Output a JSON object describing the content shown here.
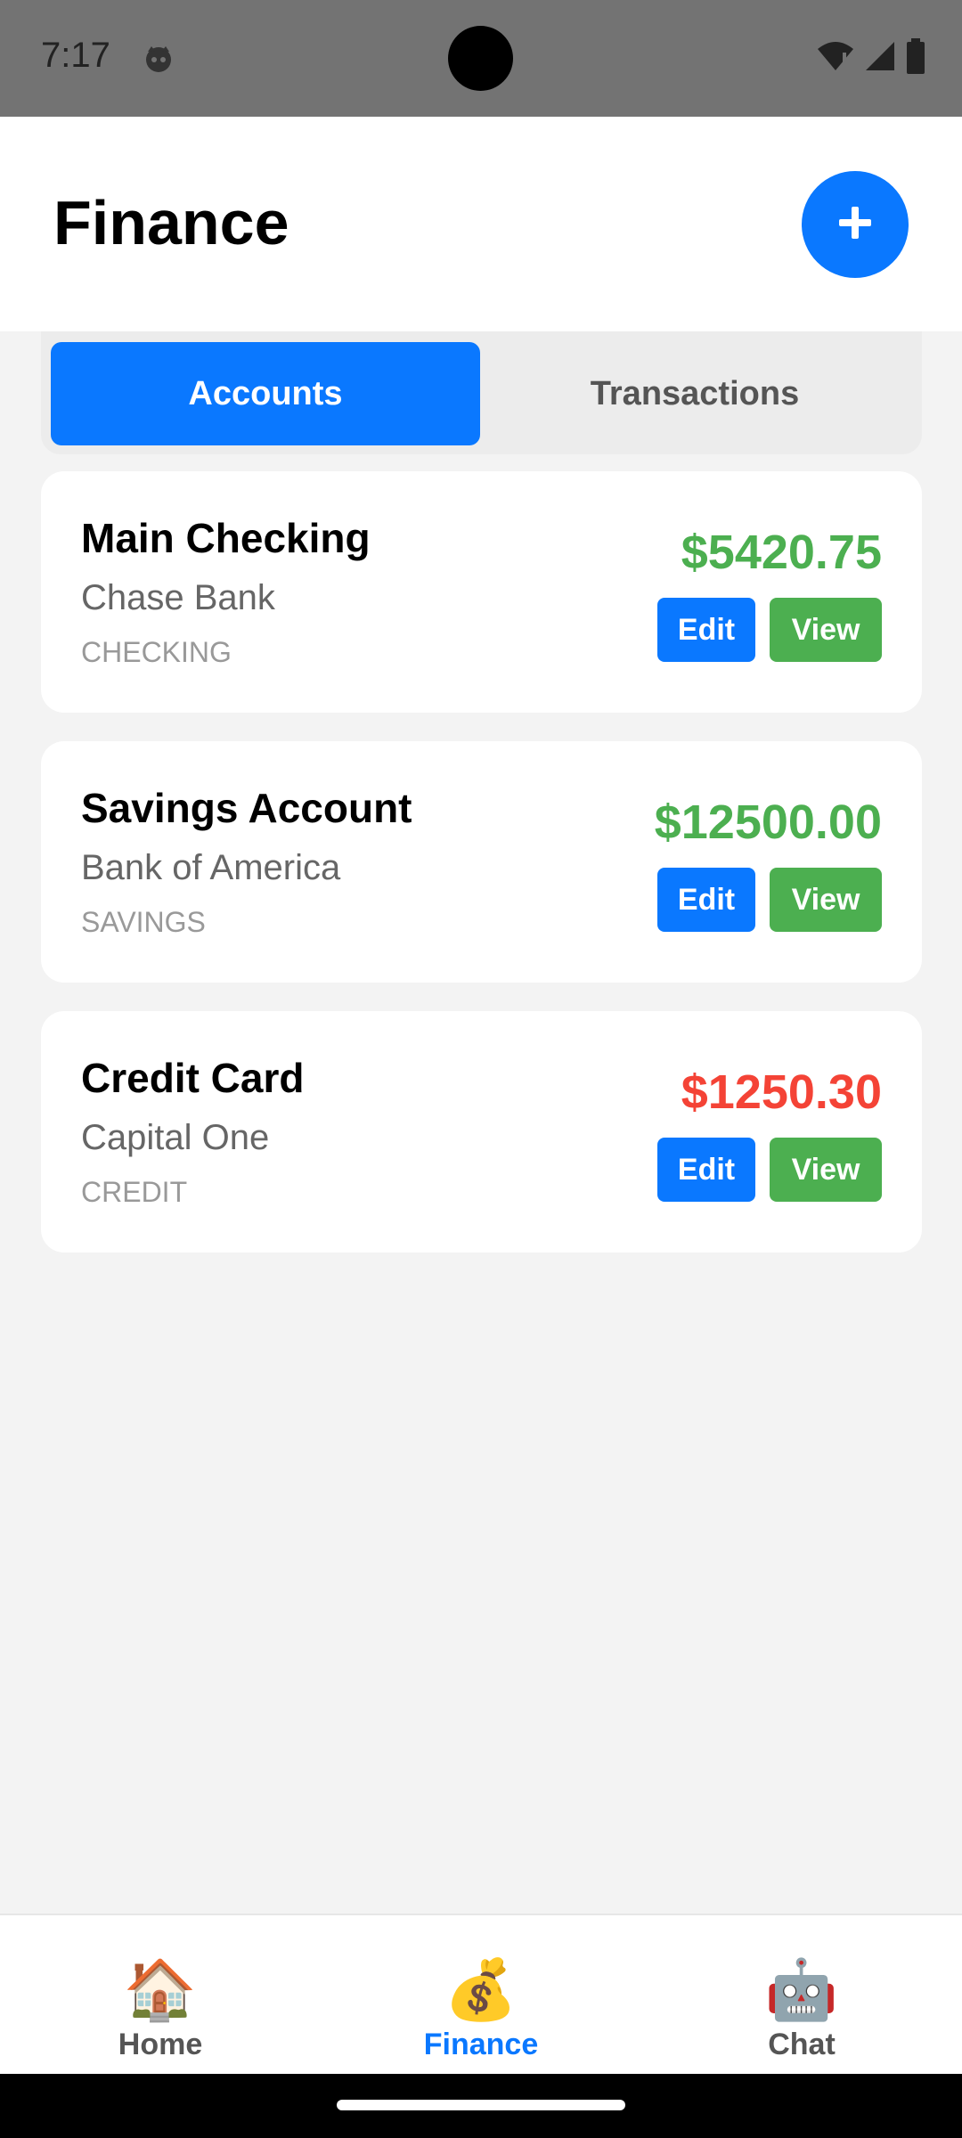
{
  "status_bar": {
    "time": "7:17"
  },
  "header": {
    "title": "Finance",
    "add_button_label": "+"
  },
  "tabs": [
    {
      "label": "Accounts",
      "selected": true
    },
    {
      "label": "Transactions",
      "selected": false
    }
  ],
  "accounts": [
    {
      "name": "Main Checking",
      "bank": "Chase Bank",
      "type": "CHECKING",
      "balance": "$5420.75",
      "balance_color": "#4caf50",
      "edit_label": "Edit",
      "view_label": "View"
    },
    {
      "name": "Savings Account",
      "bank": "Bank of America",
      "type": "SAVINGS",
      "balance": "$12500.00",
      "balance_color": "#4caf50",
      "edit_label": "Edit",
      "view_label": "View"
    },
    {
      "name": "Credit Card",
      "bank": "Capital One",
      "type": "CREDIT",
      "balance": "$1250.30",
      "balance_color": "#f44336",
      "edit_label": "Edit",
      "view_label": "View"
    }
  ],
  "bottom_nav": [
    {
      "label": "Home",
      "icon": "house-icon",
      "glyph": "🏠",
      "active": false
    },
    {
      "label": "Finance",
      "icon": "money-bag-icon",
      "glyph": "💰",
      "active": true
    },
    {
      "label": "Chat",
      "icon": "robot-icon",
      "glyph": "🤖",
      "active": false
    }
  ],
  "colors": {
    "accent": "#0a78ff",
    "positive": "#4caf50",
    "negative": "#f44336",
    "background": "#f3f3f3"
  }
}
